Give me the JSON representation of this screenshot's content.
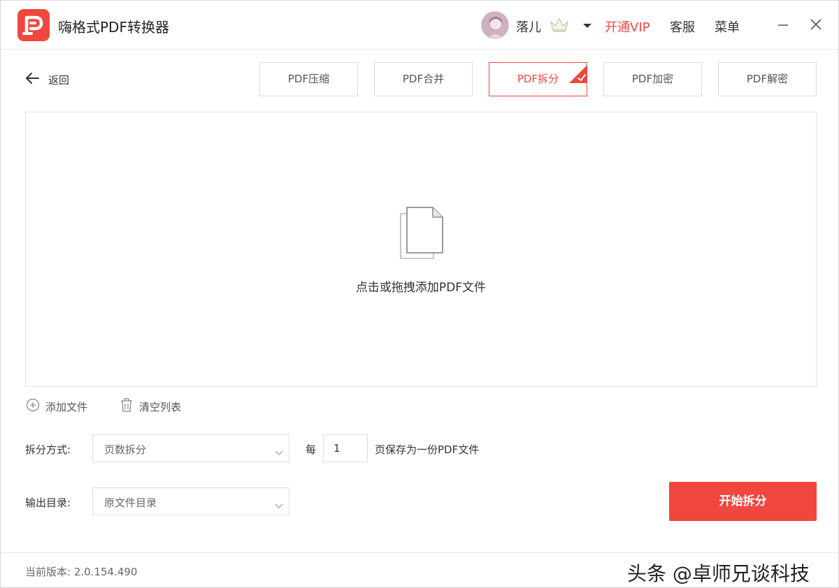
{
  "app": {
    "title": "嗨格式PDF转换器"
  },
  "header": {
    "user_name": "落儿",
    "vip_label": "开通VIP",
    "service_label": "客服",
    "menu_label": "菜单"
  },
  "nav": {
    "back_label": "返回",
    "tabs": [
      {
        "label": "PDF压缩",
        "active": false
      },
      {
        "label": "PDF合并",
        "active": false
      },
      {
        "label": "PDF拆分",
        "active": true
      },
      {
        "label": "PDF加密",
        "active": false
      },
      {
        "label": "PDF解密",
        "active": false
      }
    ]
  },
  "dropzone": {
    "hint": "点击或拖拽添加PDF文件"
  },
  "toolbar": {
    "add_file_label": "添加文件",
    "clear_list_label": "清空列表"
  },
  "settings": {
    "split_mode_label": "拆分方式:",
    "split_mode_value": "页数拆分",
    "per_label": "每",
    "pages_value": "1",
    "per_suffix": "页保存为一份PDF文件",
    "output_label": "输出目录:",
    "output_value": "原文件目录"
  },
  "actions": {
    "start_label": "开始拆分"
  },
  "footer": {
    "version": "当前版本: 2.0.154.490",
    "watermark": "头条 @卓师兄谈科技"
  },
  "colors": {
    "accent": "#f0473f",
    "border": "#dcdcdc",
    "text": "#333333"
  }
}
